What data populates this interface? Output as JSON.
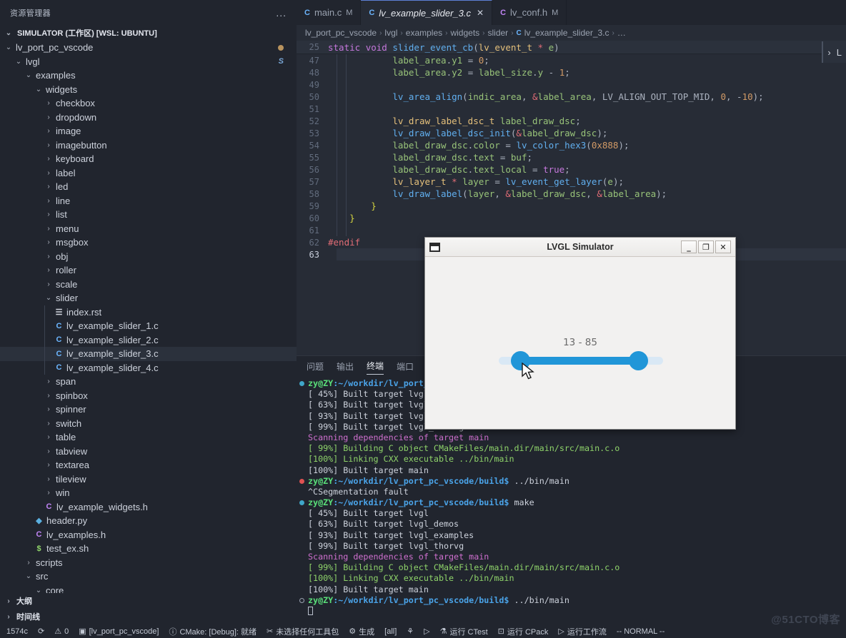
{
  "sidebar": {
    "title": "资源管理器",
    "dots": "...",
    "root": "SIMULATOR (工作区) [WSL: UBUNTU]",
    "tree": [
      {
        "depth": 1,
        "label": "lv_port_pc_vscode",
        "type": "folder",
        "open": true,
        "badge": "dot"
      },
      {
        "depth": 2,
        "label": "lvgl",
        "type": "folder",
        "open": true,
        "badge": "S"
      },
      {
        "depth": 3,
        "label": "examples",
        "type": "folder",
        "open": true
      },
      {
        "depth": 4,
        "label": "widgets",
        "type": "folder",
        "open": true
      },
      {
        "depth": 5,
        "label": "checkbox",
        "type": "folder",
        "open": false
      },
      {
        "depth": 5,
        "label": "dropdown",
        "type": "folder",
        "open": false
      },
      {
        "depth": 5,
        "label": "image",
        "type": "folder",
        "open": false
      },
      {
        "depth": 5,
        "label": "imagebutton",
        "type": "folder",
        "open": false
      },
      {
        "depth": 5,
        "label": "keyboard",
        "type": "folder",
        "open": false
      },
      {
        "depth": 5,
        "label": "label",
        "type": "folder",
        "open": false
      },
      {
        "depth": 5,
        "label": "led",
        "type": "folder",
        "open": false
      },
      {
        "depth": 5,
        "label": "line",
        "type": "folder",
        "open": false
      },
      {
        "depth": 5,
        "label": "list",
        "type": "folder",
        "open": false
      },
      {
        "depth": 5,
        "label": "menu",
        "type": "folder",
        "open": false
      },
      {
        "depth": 5,
        "label": "msgbox",
        "type": "folder",
        "open": false
      },
      {
        "depth": 5,
        "label": "obj",
        "type": "folder",
        "open": false
      },
      {
        "depth": 5,
        "label": "roller",
        "type": "folder",
        "open": false
      },
      {
        "depth": 5,
        "label": "scale",
        "type": "folder",
        "open": false
      },
      {
        "depth": 5,
        "label": "slider",
        "type": "folder",
        "open": true
      },
      {
        "depth": 6,
        "label": "index.rst",
        "type": "rst"
      },
      {
        "depth": 6,
        "label": "lv_example_slider_1.c",
        "type": "c"
      },
      {
        "depth": 6,
        "label": "lv_example_slider_2.c",
        "type": "c"
      },
      {
        "depth": 6,
        "label": "lv_example_slider_3.c",
        "type": "c",
        "selected": true
      },
      {
        "depth": 6,
        "label": "lv_example_slider_4.c",
        "type": "c"
      },
      {
        "depth": 5,
        "label": "span",
        "type": "folder",
        "open": false
      },
      {
        "depth": 5,
        "label": "spinbox",
        "type": "folder",
        "open": false
      },
      {
        "depth": 5,
        "label": "spinner",
        "type": "folder",
        "open": false
      },
      {
        "depth": 5,
        "label": "switch",
        "type": "folder",
        "open": false
      },
      {
        "depth": 5,
        "label": "table",
        "type": "folder",
        "open": false
      },
      {
        "depth": 5,
        "label": "tabview",
        "type": "folder",
        "open": false
      },
      {
        "depth": 5,
        "label": "textarea",
        "type": "folder",
        "open": false
      },
      {
        "depth": 5,
        "label": "tileview",
        "type": "folder",
        "open": false
      },
      {
        "depth": 5,
        "label": "win",
        "type": "folder",
        "open": false
      },
      {
        "depth": 5,
        "label": "lv_example_widgets.h",
        "type": "h"
      },
      {
        "depth": 4,
        "label": "header.py",
        "type": "py"
      },
      {
        "depth": 4,
        "label": "lv_examples.h",
        "type": "h"
      },
      {
        "depth": 4,
        "label": "test_ex.sh",
        "type": "sh"
      },
      {
        "depth": 3,
        "label": "scripts",
        "type": "folder",
        "open": false
      },
      {
        "depth": 3,
        "label": "src",
        "type": "folder",
        "open": true
      },
      {
        "depth": 4,
        "label": "core",
        "type": "folder",
        "open": true
      }
    ],
    "bottom_sections": [
      {
        "label": "大纲"
      },
      {
        "label": "时间线"
      }
    ]
  },
  "editor": {
    "tabs": [
      {
        "icon": "C",
        "icon_color": "#6cb6ff",
        "label": "main.c",
        "modified": "M",
        "active": false,
        "closable": false
      },
      {
        "icon": "C",
        "icon_color": "#6cb6ff",
        "label": "lv_example_slider_3.c",
        "modified": "",
        "active": true,
        "closable": true
      },
      {
        "icon": "C",
        "icon_color": "#c084f5",
        "label": "lv_conf.h",
        "modified": "M",
        "active": false,
        "closable": false
      }
    ],
    "close_glyph": "✕",
    "breadcrumb": [
      "lv_port_pc_vscode",
      "lvgl",
      "examples",
      "widgets",
      "slider",
      "lv_example_slider_3.c",
      "…"
    ],
    "breadcrumb_file_icon": "C",
    "sticky_line_no": "25",
    "sticky_code": "static void slider_event_cb(lv_event_t * e)",
    "lines": [
      {
        "no": "47",
        "text": "            label_area.y1 = 0;"
      },
      {
        "no": "48",
        "text": "            label_area.y2 = label_size.y - 1;"
      },
      {
        "no": "49",
        "text": ""
      },
      {
        "no": "50",
        "text": "            lv_area_align(indic_area, &label_area, LV_ALIGN_OUT_TOP_MID, 0, -10);"
      },
      {
        "no": "51",
        "text": ""
      },
      {
        "no": "52",
        "text": "            lv_draw_label_dsc_t label_draw_dsc;"
      },
      {
        "no": "53",
        "text": "            lv_draw_label_dsc_init(&label_draw_dsc);"
      },
      {
        "no": "54",
        "text": "            label_draw_dsc.color = lv_color_hex3(0x888);"
      },
      {
        "no": "55",
        "text": "            label_draw_dsc.text = buf;"
      },
      {
        "no": "56",
        "text": "            label_draw_dsc.text_local = true;"
      },
      {
        "no": "57",
        "text": "            lv_layer_t * layer = lv_event_get_layer(e);"
      },
      {
        "no": "58",
        "text": "            lv_draw_label(layer, &label_draw_dsc, &label_area);"
      },
      {
        "no": "59",
        "text": "        }"
      },
      {
        "no": "60",
        "text": "    }"
      },
      {
        "no": "61",
        "text": ""
      },
      {
        "no": "62",
        "text": "#endif"
      },
      {
        "no": "63",
        "text": ""
      }
    ],
    "right_arrow_glyph": "›",
    "right_arrow_label": "L"
  },
  "panel": {
    "tabs": [
      {
        "label": "问题",
        "active": false
      },
      {
        "label": "输出",
        "active": false
      },
      {
        "label": "终端",
        "active": true
      },
      {
        "label": "端口",
        "active": false
      }
    ],
    "terminal_lines": [
      {
        "dot": "ok",
        "prompt": "zy@ZY",
        "path": ":~/workdir/lv_port_pc",
        "cmd": "",
        "kind": "prompt"
      },
      {
        "text": "[ 45%] Built target lvgl",
        "kind": "white"
      },
      {
        "text": "[ 63%] Built target lvgl_d",
        "kind": "white"
      },
      {
        "text": "[ 93%] Built target lvgl_e",
        "kind": "white"
      },
      {
        "text": "[ 99%] Built target lvgl_thorvg",
        "kind": "white"
      },
      {
        "text": "Scanning dependencies of target main",
        "kind": "magenta"
      },
      {
        "text": "[ 99%] Building C object CMakeFiles/main.dir/main/src/main.c.o",
        "kind": "green"
      },
      {
        "text": "[100%] Linking CXX executable ../bin/main",
        "kind": "green"
      },
      {
        "text": "[100%] Built target main",
        "kind": "white"
      },
      {
        "dot": "err",
        "prompt": "zy@ZY",
        "path": ":~/workdir/lv_port_pc_vscode/build$",
        "cmd": " ../bin/main",
        "kind": "prompt"
      },
      {
        "text": "^CSegmentation fault",
        "kind": "white"
      },
      {
        "dot": "ok",
        "prompt": "zy@ZY",
        "path": ":~/workdir/lv_port_pc_vscode/build$",
        "cmd": " make",
        "kind": "prompt"
      },
      {
        "text": "[ 45%] Built target lvgl",
        "kind": "white"
      },
      {
        "text": "[ 63%] Built target lvgl_demos",
        "kind": "white"
      },
      {
        "text": "[ 93%] Built target lvgl_examples",
        "kind": "white"
      },
      {
        "text": "[ 99%] Built target lvgl_thorvg",
        "kind": "white"
      },
      {
        "text": "Scanning dependencies of target main",
        "kind": "magenta"
      },
      {
        "text": "[ 99%] Building C object CMakeFiles/main.dir/main/src/main.c.o",
        "kind": "green"
      },
      {
        "text": "[100%] Linking CXX executable ../bin/main",
        "kind": "green"
      },
      {
        "text": "[100%] Built target main",
        "kind": "white"
      },
      {
        "dot": "hollow",
        "prompt": "zy@ZY",
        "path": ":~/workdir/lv_port_pc_vscode/build$",
        "cmd": " ../bin/main",
        "kind": "prompt"
      },
      {
        "text": "",
        "kind": "cursor"
      }
    ]
  },
  "simulator": {
    "title": "LVGL Simulator",
    "minimize": "_",
    "maximize": "❐",
    "close": "✕",
    "slider_label": "13 - 85",
    "slider_min_value": 13,
    "slider_max_value": 85,
    "slider_range": [
      0,
      100
    ],
    "accent_color": "#2196d8",
    "track_color": "#d9e8f5"
  },
  "statusbar": {
    "left": [
      {
        "icon": "",
        "label": "1574c"
      },
      {
        "icon": "⟳",
        "label": ""
      },
      {
        "icon": "⚠",
        "label": "0"
      },
      {
        "icon": "▣",
        "label": "[lv_port_pc_vscode]"
      },
      {
        "icon": "ⓘ",
        "label": "CMake: [Debug]: 就绪"
      },
      {
        "icon": "✂",
        "label": "未选择任何工具包"
      },
      {
        "icon": "⚙",
        "label": "生成"
      },
      {
        "icon": "",
        "label": "[all]"
      },
      {
        "icon": "⚘",
        "label": ""
      },
      {
        "icon": "▷",
        "label": ""
      },
      {
        "icon": "⚗",
        "label": "运行 CTest"
      },
      {
        "icon": "⊡",
        "label": "运行 CPack"
      },
      {
        "icon": "▷",
        "label": "运行工作流"
      },
      {
        "icon": "",
        "label": "-- NORMAL --"
      }
    ]
  },
  "watermark": "@51CTO博客"
}
